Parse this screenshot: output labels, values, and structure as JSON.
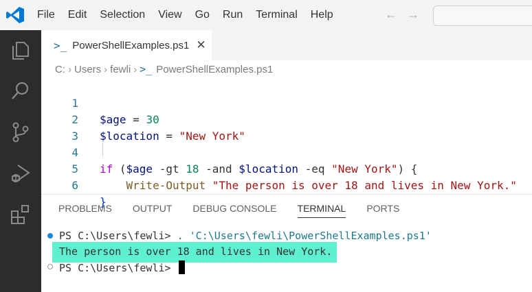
{
  "menu": [
    "File",
    "Edit",
    "Selection",
    "View",
    "Go",
    "Run",
    "Terminal",
    "Help"
  ],
  "tab": {
    "icon": "powershell-icon",
    "file": "PowerShellExamples.ps1",
    "close": "✕"
  },
  "breadcrumb": [
    "C:",
    "Users",
    "fewli",
    "PowerShellExamples.ps1"
  ],
  "editor": {
    "line_numbers": [
      "1",
      "2",
      "3",
      "4",
      "5",
      "6"
    ],
    "line1": {
      "var": "$age",
      "op": " = ",
      "num": "30"
    },
    "line2": {
      "var": "$location",
      "op": " = ",
      "str": "\"New York\""
    },
    "line4": {
      "kw": "if",
      "p1": " (",
      "var1": "$age",
      "op1": " -gt ",
      "num": "18",
      "op2": " -and ",
      "var2": "$location",
      "op3": " -eq ",
      "str": "\"New York\"",
      "p2": ") {"
    },
    "line5": {
      "cmdlet": "Write-Output",
      "str": " \"The person is over 18 and lives in New York.\""
    },
    "line6": {
      "brace": "}"
    }
  },
  "panel": {
    "tabs": [
      "PROBLEMS",
      "OUTPUT",
      "DEBUG CONSOLE",
      "TERMINAL",
      "PORTS"
    ],
    "active": "TERMINAL"
  },
  "terminal": {
    "line1_prompt": "PS C:\\Users\\fewli> ",
    "line1_cmd": ". 'C:\\Users\\fewli\\PowerShellExamples.ps1'",
    "line2": "The person is over 18 and lives in New York.",
    "line3_prompt": "PS C:\\Users\\fewli> "
  },
  "colors": {
    "accent": "#007acc",
    "highlight": "#5ff0d0",
    "activity_bar": "#2c2c2c"
  }
}
